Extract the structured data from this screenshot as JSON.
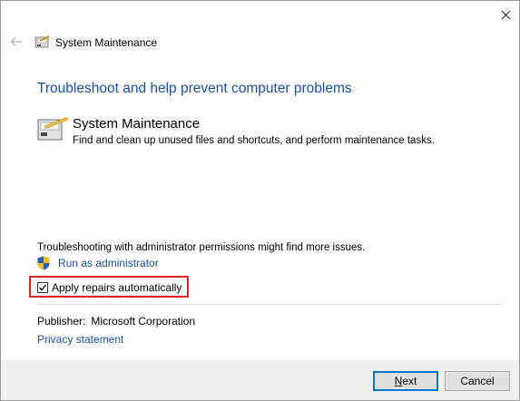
{
  "window": {
    "title": "System Maintenance"
  },
  "headline": "Troubleshoot and help prevent computer problems",
  "item": {
    "title": "System Maintenance",
    "description": "Find and clean up unused files and shortcuts, and perform maintenance tasks."
  },
  "admin": {
    "note": "Troubleshooting with administrator permissions might find more issues.",
    "run_label": "Run as administrator"
  },
  "apply_repairs": {
    "label": "Apply repairs automatically",
    "checked": true
  },
  "publisher": {
    "label": "Publisher:",
    "value": "Microsoft Corporation"
  },
  "privacy_label": "Privacy statement",
  "buttons": {
    "next_accel": "N",
    "next_rest": "ext",
    "cancel": "Cancel"
  },
  "colors": {
    "link": "#1d4fa3",
    "highlight": "#e0201f",
    "footer": "#f0f0f0"
  },
  "icons": {
    "close": "close-icon",
    "back": "back-arrow-icon",
    "maintenance": "maintenance-icon",
    "shield": "uac-shield-icon",
    "check": "checkmark-icon"
  }
}
